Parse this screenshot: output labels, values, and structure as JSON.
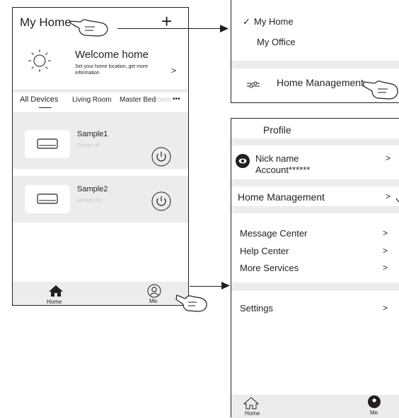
{
  "home_screen": {
    "title": "My Home",
    "add_label": "+",
    "welcome_title": "Welcome home",
    "welcome_desc_1": "Set your home location, get more",
    "welcome_desc_2": "information",
    "welcome_chevron": ">",
    "tabs": [
      "All Devices",
      "Living Room",
      "Master Bed",
      "room",
      "•••"
    ],
    "devices": [
      {
        "name": "Sample1",
        "status": "Turned off"
      },
      {
        "name": "Sample2",
        "status": "Already On"
      }
    ],
    "nav": {
      "home": "Home",
      "me": "Me"
    }
  },
  "home_dropdown": {
    "items": [
      {
        "label": "My Home",
        "checked": true
      },
      {
        "label": "My  Office",
        "checked": false
      }
    ],
    "check_glyph": "✓",
    "management_label": "Home Management"
  },
  "profile_screen": {
    "title": "Profile",
    "nickname": "Nick name",
    "account": "Account******",
    "home_management": "Home Management",
    "chevron": ">",
    "menu": [
      "Message Center",
      "Help Center",
      "More Services"
    ],
    "settings": "Settings",
    "nav": {
      "home": "Home",
      "me": "Me"
    }
  },
  "colors": {
    "line": "#231f20",
    "band": "#ececec",
    "faded": "#c8c8c8"
  }
}
